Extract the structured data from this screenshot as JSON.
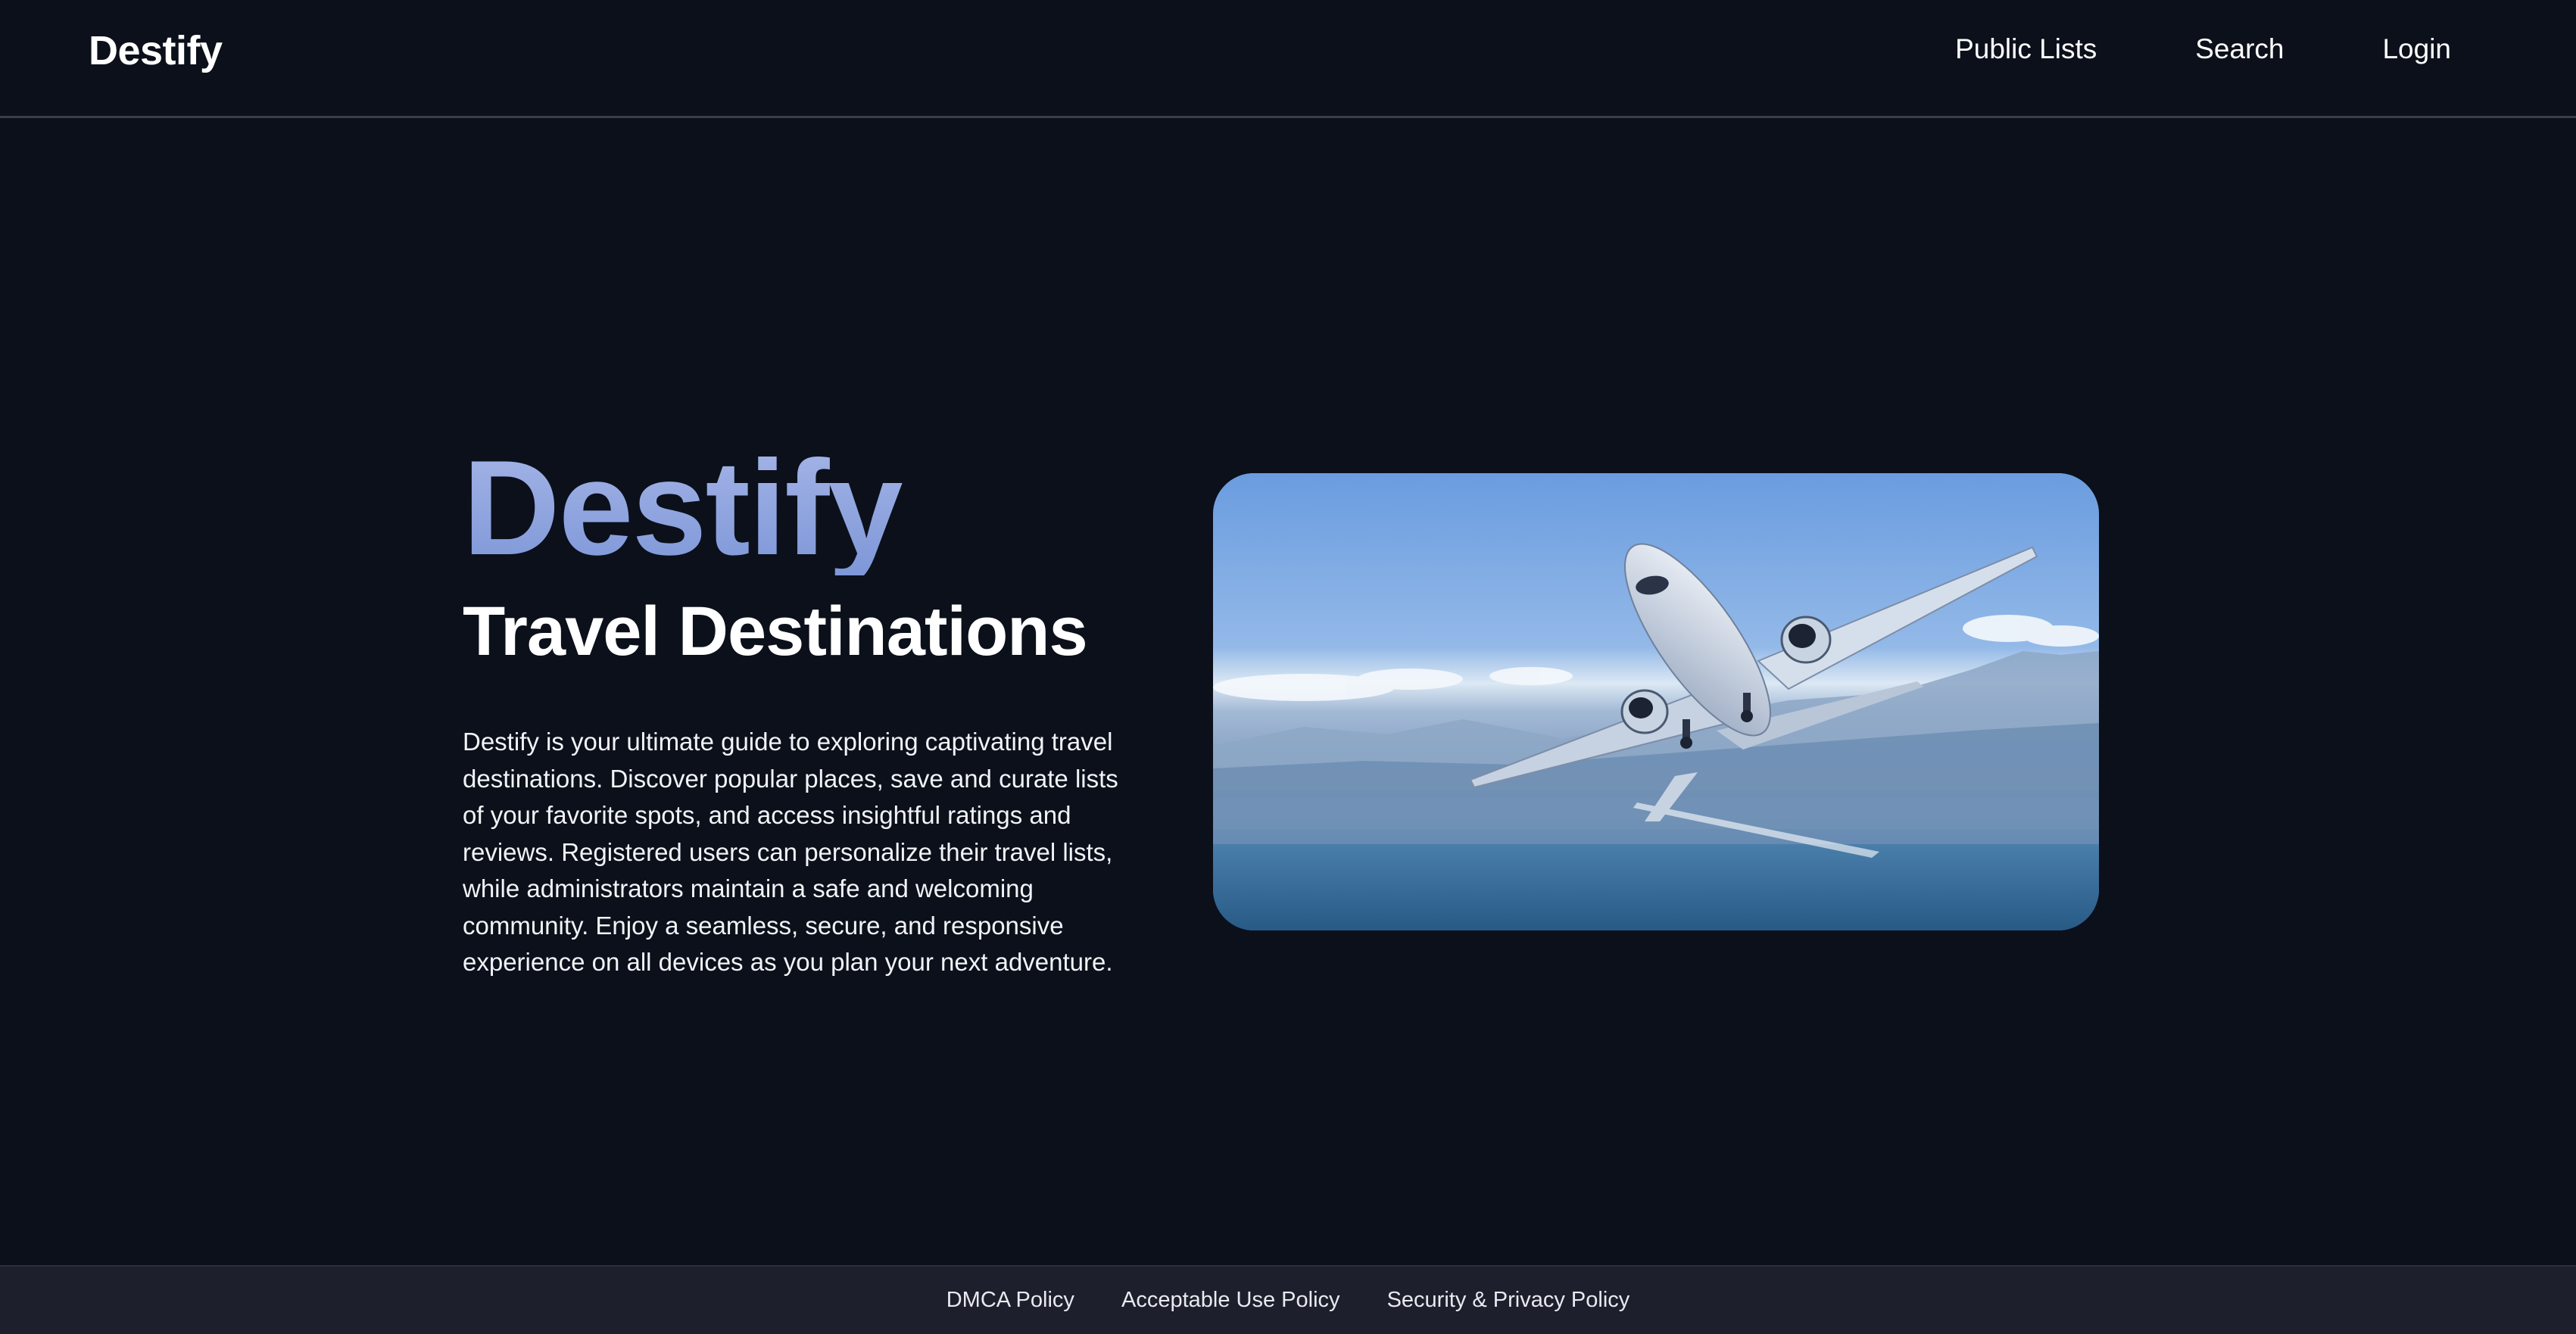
{
  "header": {
    "brand": "Destify",
    "nav": [
      {
        "label": "Public Lists"
      },
      {
        "label": "Search"
      },
      {
        "label": "Login"
      }
    ]
  },
  "hero": {
    "title": "Destify",
    "subtitle": "Travel Destinations",
    "description": "Destify is your ultimate guide to exploring captivating travel destinations. Discover popular places, save and curate lists of your favorite spots, and access insightful ratings and reviews. Registered users can personalize their travel lists, while administrators maintain a safe and welcoming community. Enjoy a seamless, secure, and responsive experience on all devices as you plan your next adventure.",
    "image": "airplane-over-coast-image"
  },
  "footer": {
    "links": [
      {
        "label": "DMCA Policy"
      },
      {
        "label": "Acceptable Use Policy"
      },
      {
        "label": "Security & Privacy Policy"
      }
    ]
  },
  "colors": {
    "background": "#0b101b",
    "accent": "#92a8e0",
    "footer_bg": "#1d1f2c"
  }
}
